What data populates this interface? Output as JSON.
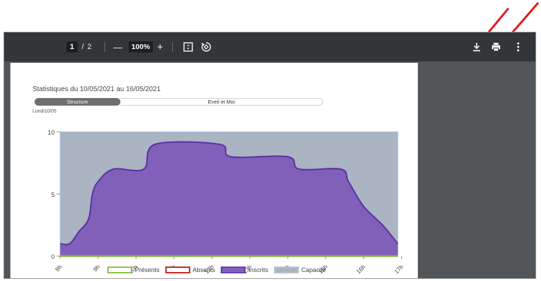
{
  "toolbar": {
    "current_page": "1",
    "page_separator": "/",
    "total_pages": "2",
    "zoom_out": "—",
    "zoom_level": "100%",
    "zoom_in": "+"
  },
  "document": {
    "title": "Statistiques du 10/05/2021 au 16/05/2021",
    "tabs": [
      {
        "label": "Structure",
        "active": true
      },
      {
        "label": "Eveil et Moi",
        "active": false
      }
    ],
    "day_label": "Lundi10/05"
  },
  "chart_data": {
    "type": "area",
    "x": [
      "8h",
      "9h",
      "10h",
      "11h",
      "12h",
      "13h",
      "14h",
      "15h",
      "16h",
      "17h"
    ],
    "yticks": [
      0,
      5,
      10
    ],
    "ylim": [
      0,
      10
    ],
    "grid": false,
    "legend_position": "bottom",
    "series": [
      {
        "name": "Présents",
        "color": "#8bc34a",
        "values": [
          0,
          0,
          0,
          0,
          0,
          0,
          0,
          0,
          0,
          0
        ]
      },
      {
        "name": "Absents",
        "color": "#c62828",
        "values": [
          0,
          0,
          0,
          0,
          0,
          0,
          0,
          0,
          0,
          0
        ]
      },
      {
        "name": "Inscrits",
        "color": "#8060b8",
        "values": [
          [
            0,
            1
          ],
          [
            0.25,
            1
          ],
          [
            0.5,
            2
          ],
          [
            0.75,
            3
          ],
          [
            0.85,
            5
          ],
          [
            1,
            6
          ],
          [
            1.4,
            7
          ],
          [
            2.2,
            7
          ],
          [
            2.5,
            9
          ],
          [
            4.2,
            9
          ],
          [
            4.5,
            8
          ],
          [
            6,
            8
          ],
          [
            6.3,
            7
          ],
          [
            7.4,
            7
          ],
          [
            7.6,
            6
          ],
          [
            8,
            4
          ],
          [
            8.5,
            2.5
          ],
          [
            8.9,
            1
          ]
        ]
      },
      {
        "name": "Capacité",
        "color": "#aab4c2",
        "values": [
          [
            0,
            10
          ],
          [
            8.9,
            10
          ]
        ]
      }
    ]
  },
  "colors": {
    "toolbar_bg": "#323639",
    "viewer_bg": "#525659",
    "annotation_arrow": "#e01b1b"
  }
}
